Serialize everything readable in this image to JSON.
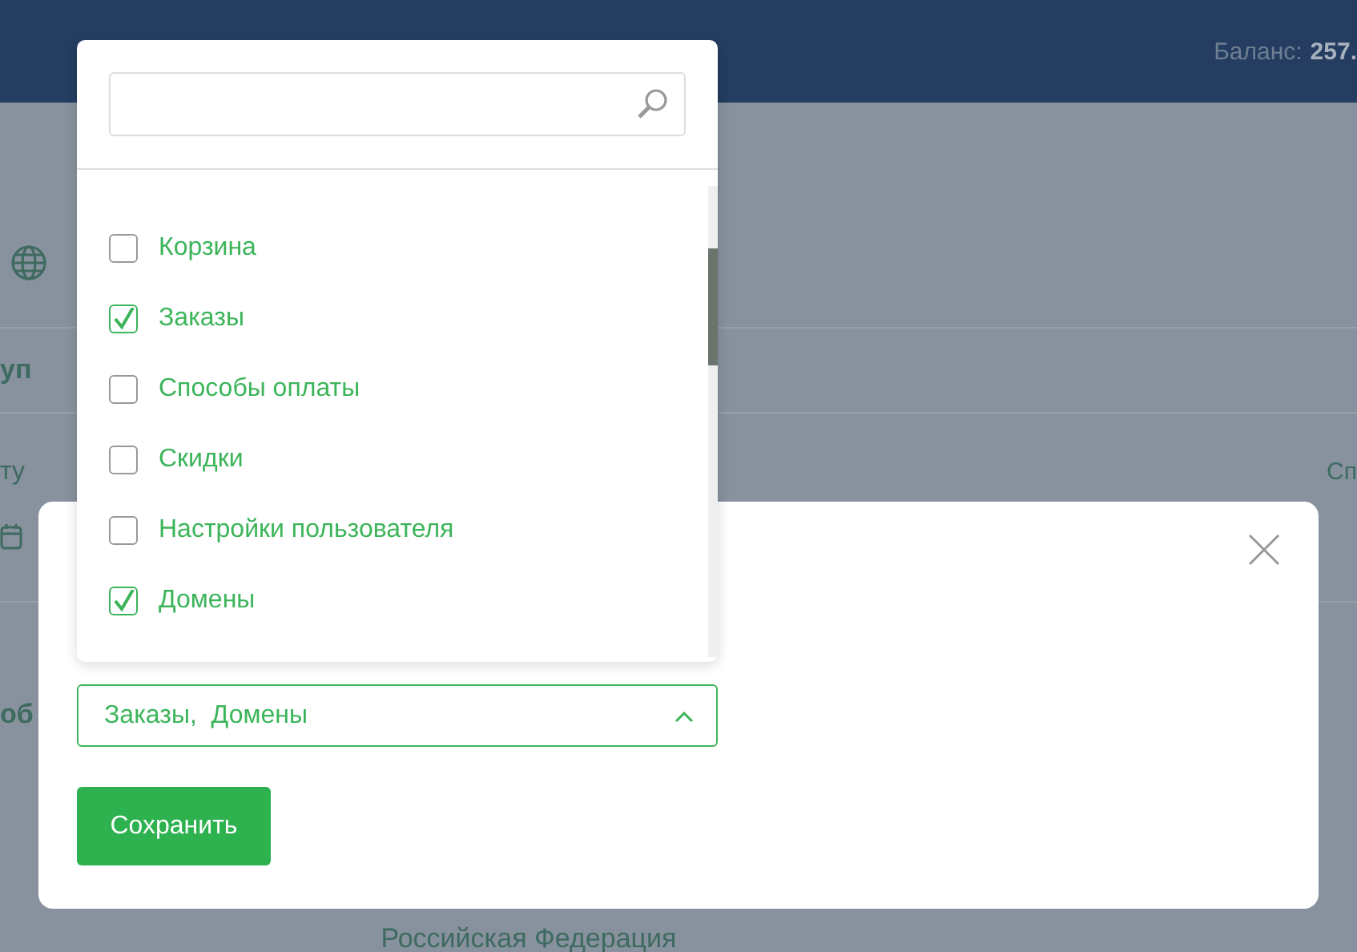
{
  "header": {
    "balance_label": "Баланс:",
    "balance_value": "257."
  },
  "background": {
    "section_heading_1": "уп",
    "card_title_1": "ту",
    "card_title_2": "Сп",
    "section_heading_2": "об",
    "country": "Российская Федерация"
  },
  "dropdown": {
    "items": [
      {
        "label": "Корзина",
        "checked": false
      },
      {
        "label": "Заказы",
        "checked": true
      },
      {
        "label": "Способы оплаты",
        "checked": false
      },
      {
        "label": "Скидки",
        "checked": false
      },
      {
        "label": "Настройки пользователя",
        "checked": false
      },
      {
        "label": "Домены",
        "checked": true
      }
    ]
  },
  "modal": {
    "select": {
      "value": "Заказы,  Домены",
      "expanded": true
    },
    "save_button": "Сохранить"
  }
}
